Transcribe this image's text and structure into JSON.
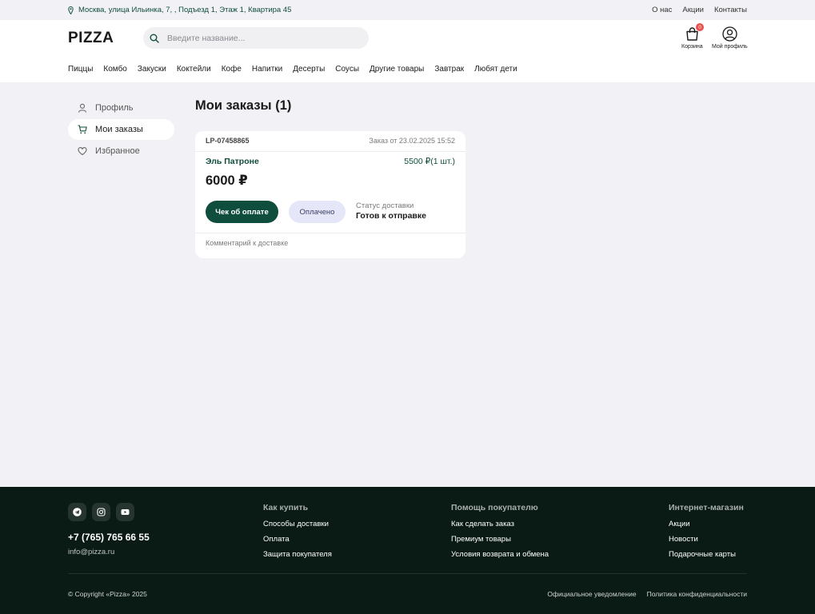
{
  "topbar": {
    "address": "Москва, улица Ильинка, 7, , Подъезд 1, Этаж 1, Квартира 45",
    "links": [
      "О нас",
      "Акции",
      "Контакты"
    ]
  },
  "header": {
    "logo": "PIZZA",
    "search_placeholder": "Введите название...",
    "cart_label": "Корзина",
    "cart_count": "0",
    "profile_label": "Мой профиль"
  },
  "categories": [
    "Пиццы",
    "Комбо",
    "Закуски",
    "Коктейли",
    "Кофе",
    "Напитки",
    "Десерты",
    "Соусы",
    "Другие товары",
    "Завтрак",
    "Любят дети"
  ],
  "sidebar": {
    "items": [
      {
        "label": "Профиль",
        "icon": "user-icon"
      },
      {
        "label": "Мои заказы",
        "icon": "cart-icon",
        "active": true
      },
      {
        "label": "Избранное",
        "icon": "heart-icon"
      }
    ]
  },
  "main": {
    "title": "Мои заказы (1)",
    "order": {
      "code": "LP-07458865",
      "date": "Заказ от 23.02.2025 15:52",
      "item_name": "Эль Патроне",
      "item_price": "5500 ₽(1 шт.)",
      "total": "6000 ₽",
      "receipt_button": "Чек об оплате",
      "payment_status": "Оплачено",
      "delivery_status_label": "Статус доставки",
      "delivery_status": "Готов к отправке",
      "comment": "Комментарий к доставке"
    }
  },
  "footer": {
    "phone": "+7 (765) 765 66 55",
    "email": "info@pizza.ru",
    "columns": [
      {
        "title": "Как купить",
        "links": [
          "Способы доставки",
          "Оплата",
          "Защита покупателя"
        ]
      },
      {
        "title": "Помощь покупателю",
        "links": [
          "Как сделать заказ",
          "Премиум товары",
          "Условия возврата и обмена"
        ]
      },
      {
        "title": "Интернет-магазин",
        "links": [
          "Акции",
          "Новости",
          "Подарочные карты"
        ]
      }
    ],
    "copyright": "© Copyright «Pizza» 2025",
    "legal": [
      "Официальное уведомление",
      "Политика конфиденциальности"
    ]
  },
  "colors": {
    "brand": "#0f4d3c",
    "footer_bg": "#0a1a15",
    "page_bg": "#f2f2f6",
    "badge": "#e8534f"
  }
}
